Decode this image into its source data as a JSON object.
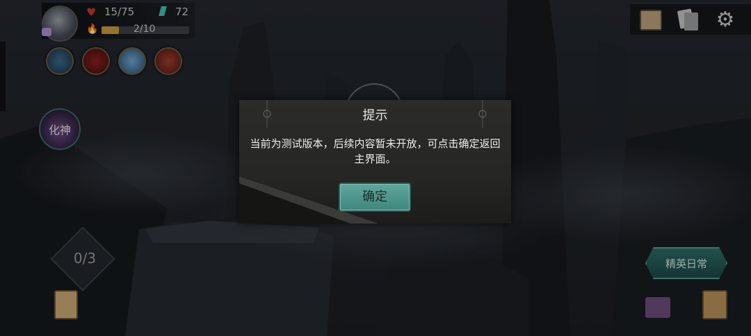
{
  "hud": {
    "health": "15/75",
    "gems": "72",
    "energy": "2/10",
    "stage_counter": "0/3",
    "portrait_label": "化神",
    "story_button": "精英日常"
  },
  "dialog": {
    "title": "提示",
    "message": "当前为测试版本，后续内容暂未开放，可点击确定返回主界面。",
    "confirm_label": "确定"
  },
  "colors": {
    "accent": "#4f978c",
    "hp": "#c0392b",
    "gem": "#3cc0b0"
  }
}
